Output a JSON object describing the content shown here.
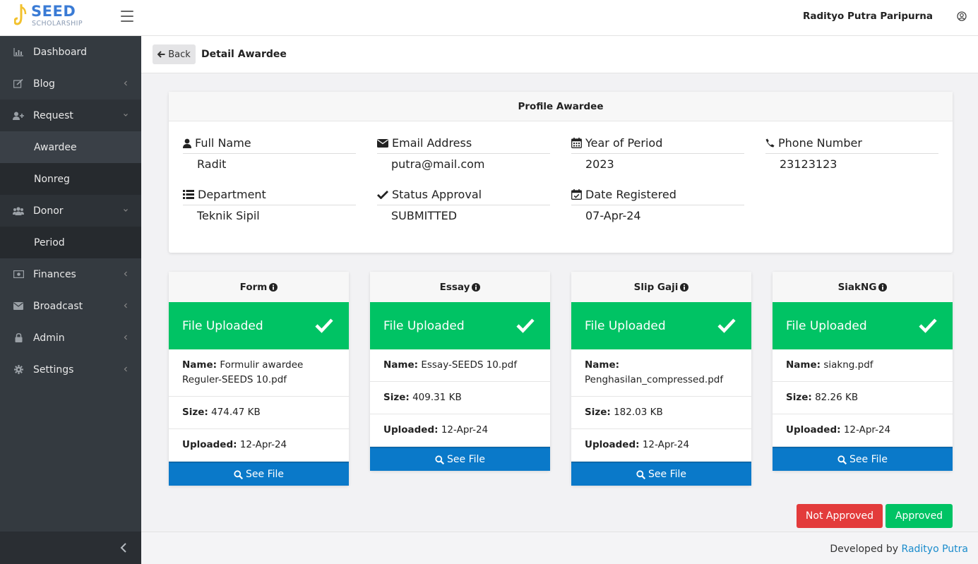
{
  "header": {
    "logo_main": "SEED",
    "logo_sub": "SCHOLARSHIP",
    "user_name": "Radityo Putra Paripurna"
  },
  "sidebar": {
    "items": [
      {
        "label": "Dashboard",
        "icon": "bar-chart-icon"
      },
      {
        "label": "Blog",
        "icon": "edit-icon"
      },
      {
        "label": "Request",
        "icon": "user-plus-icon"
      },
      {
        "label": "Awardee",
        "icon": ""
      },
      {
        "label": "Nonreg",
        "icon": ""
      },
      {
        "label": "Donor",
        "icon": "users-icon"
      },
      {
        "label": "Period",
        "icon": ""
      },
      {
        "label": "Finances",
        "icon": "money-icon"
      },
      {
        "label": "Broadcast",
        "icon": "envelope-icon"
      },
      {
        "label": "Admin",
        "icon": "lock-icon"
      },
      {
        "label": "Settings",
        "icon": "gear-icon"
      }
    ]
  },
  "content_header": {
    "back_label": "Back",
    "title": "Detail Awardee"
  },
  "profile": {
    "title": "Profile Awardee",
    "full_name_label": "Full Name",
    "full_name": "Radit",
    "email_label": "Email Address",
    "email": "putra@mail.com",
    "period_label": "Year of Period",
    "period": "2023",
    "phone_label": "Phone Number",
    "phone": "23123123",
    "department_label": "Department",
    "department": "Teknik Sipil",
    "status_label": "Status Approval",
    "status": "SUBMITTED",
    "registered_label": "Date Registered",
    "registered": "07-Apr-24"
  },
  "files": [
    {
      "title": "Form",
      "status": "File Uploaded",
      "name_label": "Name:",
      "name": "Formulir awardee Reguler-SEEDS 10.pdf",
      "size_label": "Size:",
      "size": "474.47 KB",
      "uploaded_label": "Uploaded:",
      "uploaded": "12-Apr-24",
      "see_label": "See File"
    },
    {
      "title": "Essay",
      "status": "File Uploaded",
      "name_label": "Name:",
      "name": "Essay-SEEDS 10.pdf",
      "size_label": "Size:",
      "size": "409.31 KB",
      "uploaded_label": "Uploaded:",
      "uploaded": "12-Apr-24",
      "see_label": "See File"
    },
    {
      "title": "Slip Gaji",
      "status": "File Uploaded",
      "name_label": "Name:",
      "name": "Penghasilan_compressed.pdf",
      "size_label": "Size:",
      "size": "182.03 KB",
      "uploaded_label": "Uploaded:",
      "uploaded": "12-Apr-24",
      "see_label": "See File"
    },
    {
      "title": "SiakNG",
      "status": "File Uploaded",
      "name_label": "Name:",
      "name": "siakng.pdf",
      "size_label": "Size:",
      "size": "82.26 KB",
      "uploaded_label": "Uploaded:",
      "uploaded": "12-Apr-24",
      "see_label": "See File"
    }
  ],
  "actions": {
    "not_approved": "Not Approved",
    "approved": "Approved"
  },
  "footer": {
    "prefix": "Developed by",
    "author": "Radityo Putra"
  },
  "colors": {
    "sidebar_bg": "#343a40",
    "success": "#00c364",
    "primary": "#0a79c9",
    "danger": "#e33b3b",
    "link": "#1a8ccc"
  }
}
